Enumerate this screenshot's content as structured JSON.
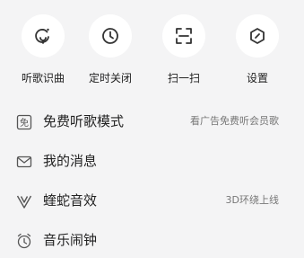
{
  "quick_actions": [
    {
      "label": "听歌识曲",
      "icon": "recognize-song-icon"
    },
    {
      "label": "定时关闭",
      "icon": "clock-icon"
    },
    {
      "label": "扫一扫",
      "icon": "scan-icon"
    },
    {
      "label": "设置",
      "icon": "settings-icon"
    }
  ],
  "menu": [
    {
      "label": "免费听歌模式",
      "hint": "看广告免费听会员歌",
      "icon": "free-badge-icon",
      "icon_text": "免"
    },
    {
      "label": "我的消息",
      "hint": "",
      "icon": "envelope-icon"
    },
    {
      "label": "蝰蛇音效",
      "hint": "3D环绕上线",
      "icon": "viper-icon"
    },
    {
      "label": "音乐闹钟",
      "hint": "",
      "icon": "alarm-clock-icon"
    }
  ],
  "colors": {
    "background": "#f4f4f5",
    "icon": "#333333",
    "text": "#222222",
    "hint": "#777777"
  }
}
